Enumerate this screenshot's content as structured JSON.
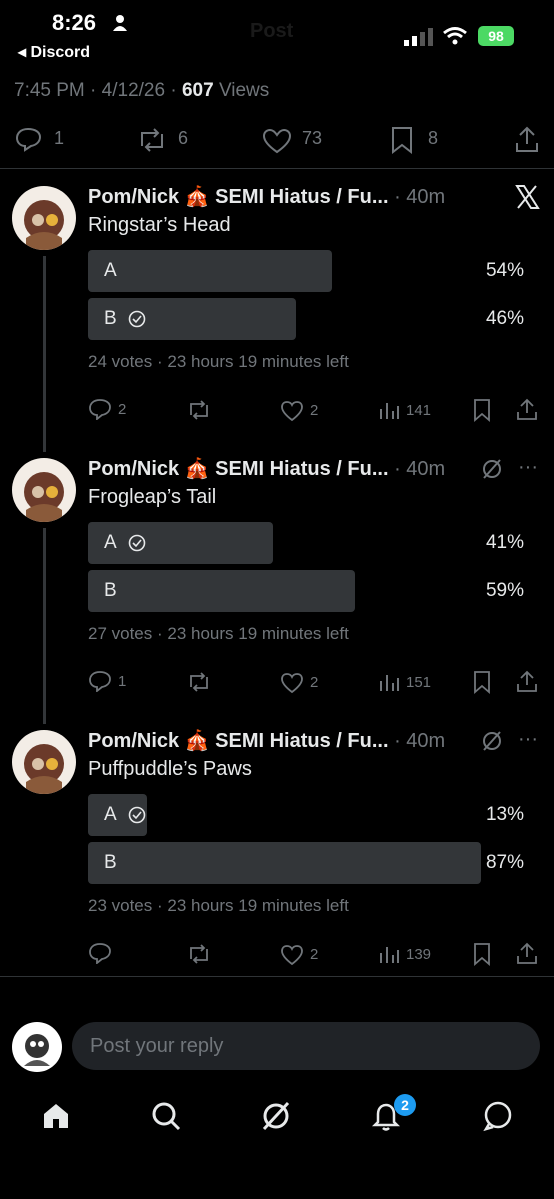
{
  "status_bar": {
    "time": "8:26",
    "back_app": "Discord",
    "battery": "98"
  },
  "header": {
    "title": "Post"
  },
  "post_meta": {
    "time": "7:45 PM",
    "date": "4/12/26",
    "views": "607",
    "views_label": "Views",
    "separator": "·"
  },
  "post_actions": {
    "replies": "1",
    "reposts": "6",
    "likes": "73",
    "bookmarks": "8"
  },
  "tweets": [
    {
      "author": "Pom/Nick 🎪 SEMI Hiatus / Fu...",
      "time": "40m",
      "text": "Ringstar’s Head",
      "options": [
        {
          "label": "A",
          "pct": "54%",
          "share": 0.54,
          "voted": false
        },
        {
          "label": "B",
          "pct": "46%",
          "share": 0.46,
          "voted": true
        }
      ],
      "poll_meta": "24 votes · 23 hours 19 minutes left",
      "replies": "2",
      "likes": "2",
      "views": "141"
    },
    {
      "author": "Pom/Nick 🎪 SEMI Hiatus / Fu...",
      "time": "40m",
      "text": "Frogleap’s Tail",
      "options": [
        {
          "label": "A",
          "pct": "41%",
          "share": 0.41,
          "voted": true
        },
        {
          "label": "B",
          "pct": "59%",
          "share": 0.59,
          "voted": false
        }
      ],
      "poll_meta": "27 votes · 23 hours 19 minutes left",
      "replies": "1",
      "likes": "2",
      "views": "151"
    },
    {
      "author": "Pom/Nick 🎪 SEMI Hiatus / Fu...",
      "time": "40m",
      "text": "Puffpuddle’s Paws",
      "options": [
        {
          "label": "A",
          "pct": "13%",
          "share": 0.13,
          "voted": true
        },
        {
          "label": "B",
          "pct": "87%",
          "share": 0.87,
          "voted": false
        }
      ],
      "poll_meta": "23 votes · 23 hours 19 minutes left",
      "replies": "",
      "likes": "2",
      "views": "139"
    }
  ],
  "reply": {
    "placeholder": "Post your reply"
  },
  "nav": {
    "notifications_badge": "2"
  },
  "colors": {
    "background": "#000000",
    "accent": "#1d9bf0",
    "muted": "#71767b",
    "bar": "#333639"
  }
}
